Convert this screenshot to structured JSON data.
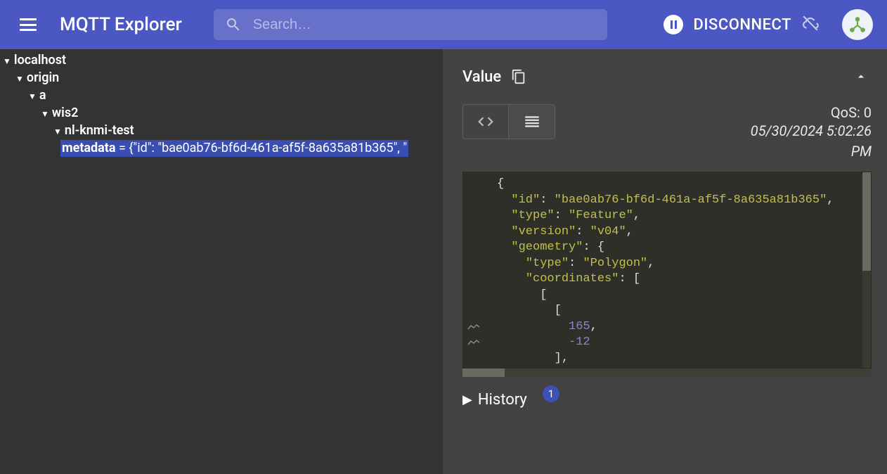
{
  "header": {
    "app_title": "MQTT Explorer",
    "search_placeholder": "Search…",
    "disconnect_label": "DISCONNECT"
  },
  "tree": {
    "root": "localhost",
    "l1": "origin",
    "l2": "a",
    "l3": "wis2",
    "l4": "nl-knmi-test",
    "metadata_key": "metadata",
    "metadata_eq": " = ",
    "metadata_preview": "{\"id\": \"bae0ab76-bf6d-461a-af5f-8a635a81b365\", \""
  },
  "value_panel": {
    "title": "Value",
    "qos_label": "QoS: 0",
    "timestamp_line1": "05/30/2024 5:02:26",
    "timestamp_line2": "PM",
    "json_lines": [
      {
        "indent": 0,
        "tokens": [
          {
            "t": "p",
            "v": "{"
          }
        ]
      },
      {
        "indent": 1,
        "tokens": [
          {
            "t": "k",
            "v": "\"id\""
          },
          {
            "t": "p",
            "v": ": "
          },
          {
            "t": "s",
            "v": "\"bae0ab76-bf6d-461a-af5f-8a635a81b365\""
          },
          {
            "t": "p",
            "v": ","
          }
        ]
      },
      {
        "indent": 1,
        "tokens": [
          {
            "t": "k",
            "v": "\"type\""
          },
          {
            "t": "p",
            "v": ": "
          },
          {
            "t": "s",
            "v": "\"Feature\""
          },
          {
            "t": "p",
            "v": ","
          }
        ]
      },
      {
        "indent": 1,
        "tokens": [
          {
            "t": "k",
            "v": "\"version\""
          },
          {
            "t": "p",
            "v": ": "
          },
          {
            "t": "s",
            "v": "\"v04\""
          },
          {
            "t": "p",
            "v": ","
          }
        ]
      },
      {
        "indent": 1,
        "tokens": [
          {
            "t": "k",
            "v": "\"geometry\""
          },
          {
            "t": "p",
            "v": ": {"
          }
        ]
      },
      {
        "indent": 2,
        "tokens": [
          {
            "t": "k",
            "v": "\"type\""
          },
          {
            "t": "p",
            "v": ": "
          },
          {
            "t": "s",
            "v": "\"Polygon\""
          },
          {
            "t": "p",
            "v": ","
          }
        ]
      },
      {
        "indent": 2,
        "tokens": [
          {
            "t": "k",
            "v": "\"coordinates\""
          },
          {
            "t": "p",
            "v": ": ["
          }
        ]
      },
      {
        "indent": 3,
        "tokens": [
          {
            "t": "p",
            "v": "["
          }
        ]
      },
      {
        "indent": 4,
        "tokens": [
          {
            "t": "p",
            "v": "["
          }
        ]
      },
      {
        "indent": 5,
        "tokens": [
          {
            "t": "n",
            "v": "165"
          },
          {
            "t": "p",
            "v": ","
          }
        ]
      },
      {
        "indent": 5,
        "tokens": [
          {
            "t": "n",
            "v": "-12"
          }
        ]
      },
      {
        "indent": 4,
        "tokens": [
          {
            "t": "p",
            "v": "],"
          }
        ]
      }
    ]
  },
  "history": {
    "title": "History",
    "badge": "1"
  }
}
